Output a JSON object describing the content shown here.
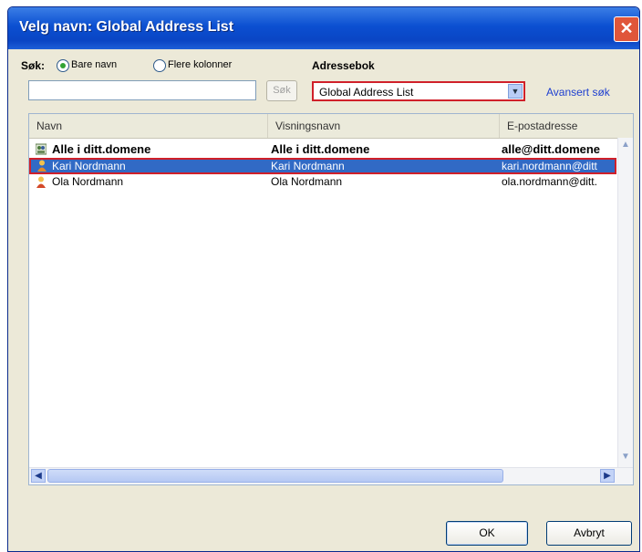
{
  "window": {
    "title": "Velg navn: Global Address List",
    "close_glyph": "✕"
  },
  "search": {
    "label": "Søk:",
    "options": [
      {
        "label": "Bare navn",
        "selected": true
      },
      {
        "label": "Flere kolonner",
        "selected": false
      }
    ],
    "input_value": "",
    "button_label": "Søk"
  },
  "addressbook": {
    "label": "Adressebok",
    "selected": "Global Address List",
    "advanced_link": "Avansert søk"
  },
  "list": {
    "columns": [
      "Navn",
      "Visningsnavn",
      "E-postadresse"
    ],
    "rows": [
      {
        "name": "Alle i ditt.domene",
        "display": "Alle i ditt.domene",
        "email": "alle@ditt.domene",
        "icon": "group-icon",
        "bold": true,
        "selected": false
      },
      {
        "name": "Kari Nordmann",
        "display": "Kari Nordmann",
        "email": "kari.nordmann@ditt",
        "icon": "user-icon",
        "bold": false,
        "selected": true
      },
      {
        "name": "Ola Nordmann",
        "display": "Ola Nordmann",
        "email": "ola.nordmann@ditt.",
        "icon": "user-icon",
        "bold": false,
        "selected": false
      }
    ]
  },
  "buttons": {
    "ok": "OK",
    "cancel": "Avbryt"
  },
  "colors": {
    "title_bar": "#0b4fd1",
    "selection": "#316ac5",
    "highlight_border": "#d0202a",
    "link": "#1e3fd0"
  }
}
